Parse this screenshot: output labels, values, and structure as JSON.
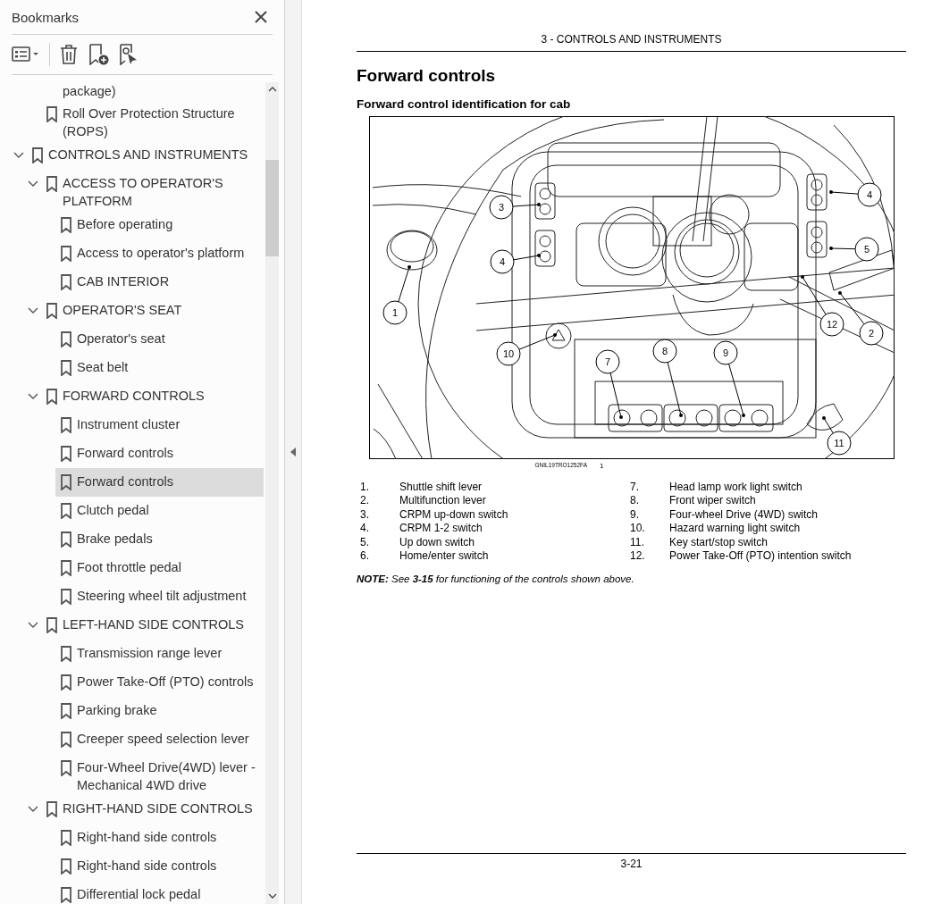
{
  "sidebar": {
    "title": "Bookmarks",
    "continued_text": "package)",
    "top_items": [
      {
        "label": "Roll Over Protection Structure (ROPS)",
        "selected": false
      }
    ],
    "tree": [
      {
        "label": "CONTROLS AND INSTRUMENTS",
        "expanded": true,
        "children": [
          {
            "label": "ACCESS TO OPERATOR'S PLATFORM",
            "expanded": true,
            "children": [
              {
                "label": "Before operating",
                "selected": false
              },
              {
                "label": "Access to operator's platform",
                "selected": false
              },
              {
                "label": "CAB INTERIOR",
                "selected": false
              }
            ]
          },
          {
            "label": "OPERATOR'S SEAT",
            "expanded": true,
            "children": [
              {
                "label": "Operator's seat",
                "selected": false
              },
              {
                "label": "Seat belt",
                "selected": false
              }
            ]
          },
          {
            "label": "FORWARD CONTROLS",
            "expanded": true,
            "children": [
              {
                "label": "Instrument cluster",
                "selected": false
              },
              {
                "label": "Forward controls",
                "selected": false
              },
              {
                "label": "Forward controls",
                "selected": true
              },
              {
                "label": "Clutch pedal",
                "selected": false
              },
              {
                "label": "Brake pedals",
                "selected": false
              },
              {
                "label": "Foot throttle pedal",
                "selected": false
              },
              {
                "label": "Steering wheel tilt adjustment",
                "selected": false
              }
            ]
          },
          {
            "label": "LEFT-HAND SIDE CONTROLS",
            "expanded": true,
            "children": [
              {
                "label": "Transmission range lever",
                "selected": false
              },
              {
                "label": "Power Take-Off (PTO) controls",
                "selected": false
              },
              {
                "label": "Parking brake",
                "selected": false
              },
              {
                "label": "Creeper speed selection lever",
                "selected": false
              },
              {
                "label": "Four-Wheel Drive(4WD) lever - Mechanical 4WD drive",
                "selected": false
              }
            ]
          },
          {
            "label": "RIGHT-HAND SIDE CONTROLS",
            "expanded": true,
            "children": [
              {
                "label": "Right-hand side controls",
                "selected": false
              },
              {
                "label": "Right-hand side controls",
                "selected": false
              },
              {
                "label": "Differential lock pedal",
                "selected": false
              }
            ]
          }
        ]
      }
    ]
  },
  "document": {
    "header": "3 - CONTROLS AND INSTRUMENTS",
    "title": "Forward controls",
    "subtitle": "Forward control identification for cab",
    "figure": {
      "callouts": [
        "3",
        "4",
        "4",
        "5",
        "1",
        "12",
        "2",
        "10",
        "7",
        "8",
        "9",
        "11"
      ],
      "code": "GNIL19TRO1252FA",
      "number": "1"
    },
    "legend": [
      {
        "number": "1.",
        "text": "Shuttle shift lever"
      },
      {
        "number": "2.",
        "text": "Multifunction lever"
      },
      {
        "number": "3.",
        "text": "CRPM up-down switch"
      },
      {
        "number": "4.",
        "text": "CRPM 1-2 switch"
      },
      {
        "number": "5.",
        "text": "Up down switch"
      },
      {
        "number": "6.",
        "text": "Home/enter switch"
      },
      {
        "number": "7.",
        "text": "Head lamp work light switch"
      },
      {
        "number": "8.",
        "text": "Front wiper switch"
      },
      {
        "number": "9.",
        "text": "Four-wheel Drive (4WD) switch"
      },
      {
        "number": "10.",
        "text": "Hazard warning light switch"
      },
      {
        "number": "11.",
        "text": "Key start/stop switch"
      },
      {
        "number": "12.",
        "text": "Power Take-Off (PTO) intention switch"
      }
    ],
    "note": "**NOTE:** See **3-15** for functioning of the controls shown above.",
    "page_number": "3-21"
  }
}
